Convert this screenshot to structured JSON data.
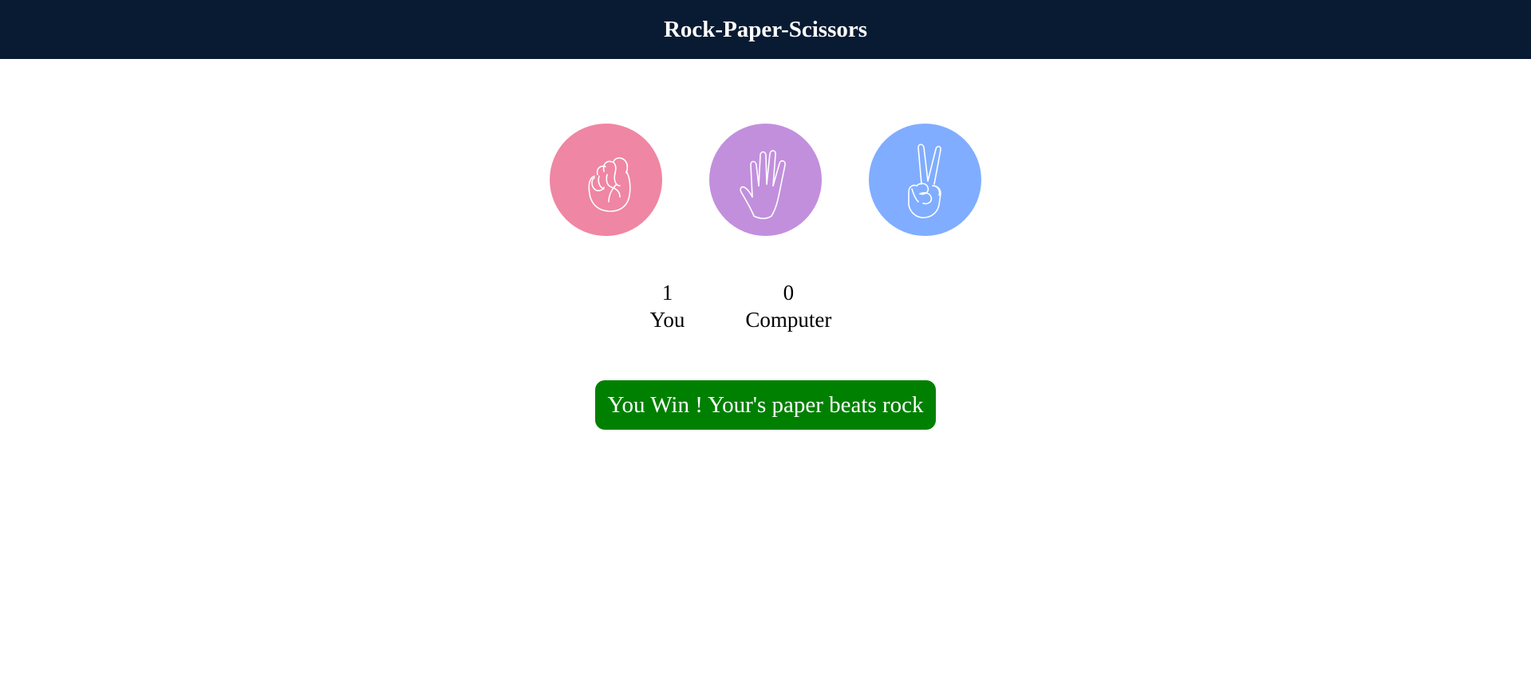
{
  "header": {
    "title": "Rock-Paper-Scissors"
  },
  "choices": [
    {
      "id": "rock",
      "icon": "fist-icon",
      "color": "#ef86a3"
    },
    {
      "id": "paper",
      "icon": "open-hand-icon",
      "color": "#c28fdd"
    },
    {
      "id": "scissors",
      "icon": "peace-hand-icon",
      "color": "#80adff"
    }
  ],
  "scores": {
    "user": {
      "value": "1",
      "label": "You"
    },
    "computer": {
      "value": "0",
      "label": "Computer"
    }
  },
  "message": {
    "text": "You Win ! Your's paper beats rock",
    "color": "#008000"
  }
}
